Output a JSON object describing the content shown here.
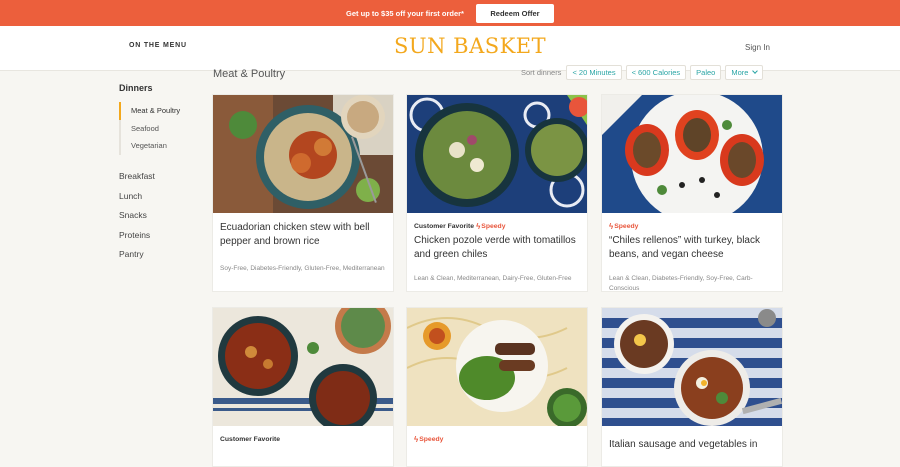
{
  "promo": {
    "text": "Get up to $35 off your first order*",
    "button": "Redeem Offer"
  },
  "header": {
    "menu_link": "ON THE MENU",
    "logo": "SUN BASKET",
    "sign_in": "Sign In"
  },
  "sidebar": {
    "title": "Dinners",
    "sub_items": [
      "Meat & Poultry",
      "Seafood",
      "Vegetarian"
    ],
    "categories": [
      "Breakfast",
      "Lunch",
      "Snacks",
      "Proteins",
      "Pantry"
    ]
  },
  "main": {
    "title": "Meat & Poultry",
    "sort_label": "Sort dinners",
    "filters": [
      "< 20 Minutes",
      "< 600 Calories",
      "Paleo"
    ],
    "more": "More"
  },
  "cards": [
    {
      "favorite": "",
      "speedy": "",
      "title": "Ecuadorian chicken stew with bell pepper and brown rice",
      "tags": "Soy-Free, Diabetes-Friendly, Gluten-Free, Mediterranean"
    },
    {
      "favorite": "Customer Favorite",
      "speedy": "Speedy",
      "title": "Chicken pozole verde with tomatillos and green chiles",
      "tags": "Lean & Clean, Mediterranean, Dairy-Free, Gluten-Free"
    },
    {
      "favorite": "",
      "speedy": "Speedy",
      "title": "“Chiles rellenos” with turkey, black beans, and vegan cheese",
      "tags": "Lean & Clean, Diabetes-Friendly, Soy-Free, Carb-Conscious"
    },
    {
      "favorite": "Customer Favorite",
      "speedy": "",
      "title": "",
      "tags": ""
    },
    {
      "favorite": "",
      "speedy": "Speedy",
      "title": "",
      "tags": ""
    },
    {
      "favorite": "",
      "speedy": "",
      "title": "Italian sausage and vegetables in",
      "tags": ""
    }
  ],
  "colors": {
    "accent": "#ec5f3c",
    "logo": "#f3a81d",
    "link": "#2aa5a5",
    "speedy": "#e8553b"
  }
}
